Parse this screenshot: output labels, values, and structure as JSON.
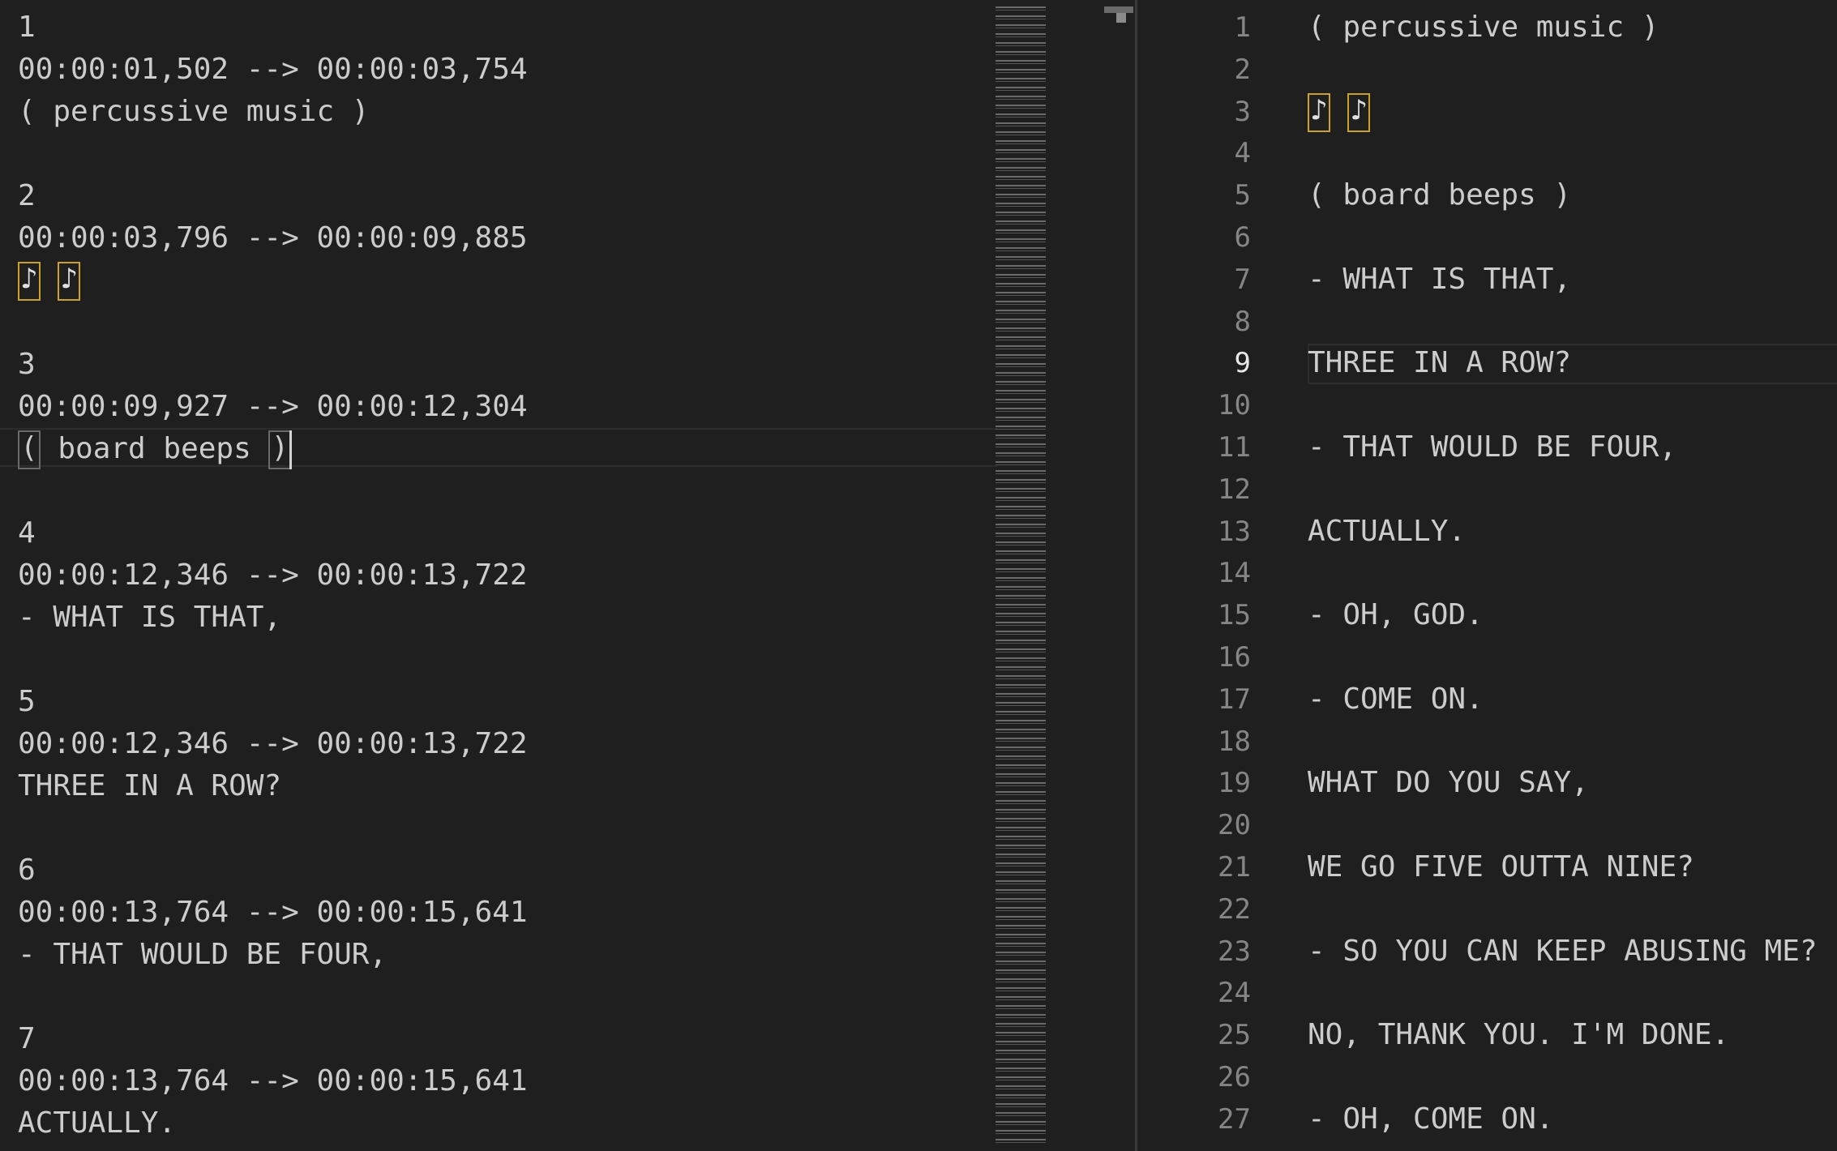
{
  "left_editor": {
    "lines": [
      "1",
      "00:00:01,502 --> 00:00:03,754",
      "( percussive music )",
      "",
      "2",
      "00:00:03,796 --> 00:00:09,885",
      "♪ ♪",
      "",
      "3",
      "00:00:09,927 --> 00:00:12,304",
      "( board beeps )",
      "",
      "4",
      "00:00:12,346 --> 00:00:13,722",
      "- WHAT IS THAT,",
      "",
      "5",
      "00:00:12,346 --> 00:00:13,722",
      "THREE IN A ROW?",
      "",
      "6",
      "00:00:13,764 --> 00:00:15,641",
      "- THAT WOULD BE FOUR,",
      "",
      "7",
      "00:00:13,764 --> 00:00:15,641",
      "ACTUALLY."
    ],
    "note_glyph": "♪",
    "bracket_open": "(",
    "bracket_close": ")",
    "bracket_inner": " board beeps "
  },
  "right_editor": {
    "active_line": 9,
    "line_numbers": [
      "1",
      "2",
      "3",
      "4",
      "5",
      "6",
      "7",
      "8",
      "9",
      "10",
      "11",
      "12",
      "13",
      "14",
      "15",
      "16",
      "17",
      "18",
      "19",
      "20",
      "21",
      "22",
      "23",
      "24",
      "25",
      "26",
      "27"
    ],
    "lines": [
      "( percussive music )",
      "",
      "♪ ♪",
      "",
      "( board beeps )",
      "",
      "- WHAT IS THAT,",
      "",
      "THREE IN A ROW?",
      "",
      "- THAT WOULD BE FOUR,",
      "",
      "ACTUALLY.",
      "",
      "- OH, GOD.",
      "",
      "- COME ON.",
      "",
      "WHAT DO YOU SAY,",
      "",
      "WE GO FIVE OUTTA NINE?",
      "",
      "- SO YOU CAN KEEP ABUSING ME?",
      "",
      "NO, THANK YOU. I'M DONE.",
      "",
      "- OH, COME ON."
    ]
  },
  "colors": {
    "background": "#1f1f1f",
    "text": "#cccccc",
    "line_number": "#858585",
    "bracket_highlight": "#c9a227"
  }
}
